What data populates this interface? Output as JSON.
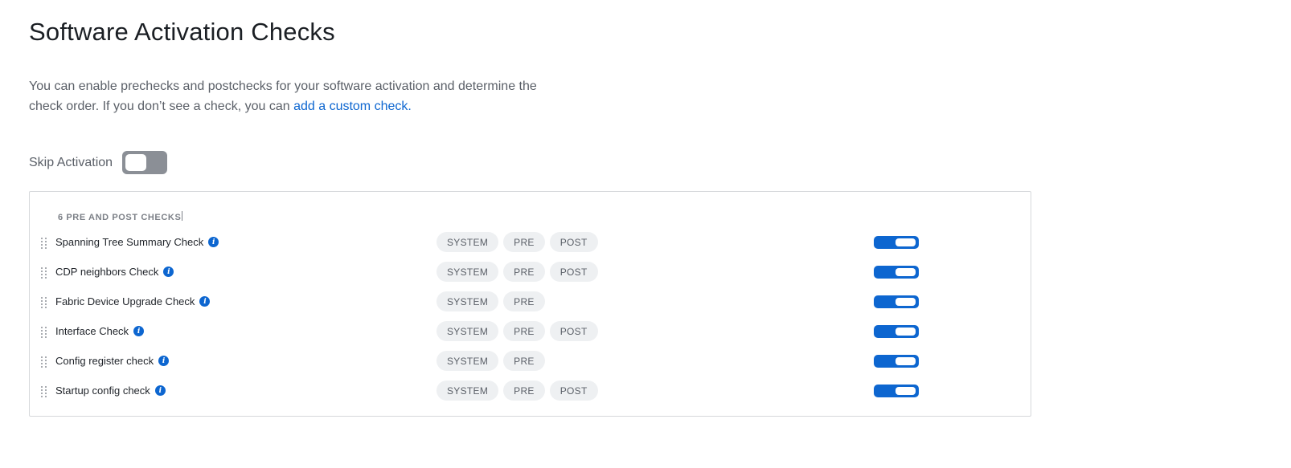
{
  "page": {
    "title": "Software Activation Checks",
    "description_text": "You can enable prechecks and postchecks for your software activation and determine the check order. If you don’t see a check, you can ",
    "description_link": "add a custom check."
  },
  "skip_activation": {
    "label": "Skip Activation",
    "enabled": false
  },
  "checks": {
    "header": "6 PRE AND POST CHECKS",
    "items": [
      {
        "name": "Spanning Tree Summary Check",
        "tags": [
          "SYSTEM",
          "PRE",
          "POST"
        ],
        "enabled": true
      },
      {
        "name": "CDP neighbors Check",
        "tags": [
          "SYSTEM",
          "PRE",
          "POST"
        ],
        "enabled": true
      },
      {
        "name": "Fabric Device Upgrade Check",
        "tags": [
          "SYSTEM",
          "PRE"
        ],
        "enabled": true
      },
      {
        "name": "Interface Check",
        "tags": [
          "SYSTEM",
          "PRE",
          "POST"
        ],
        "enabled": true
      },
      {
        "name": "Config register check",
        "tags": [
          "SYSTEM",
          "PRE"
        ],
        "enabled": true
      },
      {
        "name": "Startup config check",
        "tags": [
          "SYSTEM",
          "PRE",
          "POST"
        ],
        "enabled": true
      }
    ]
  },
  "icons": {
    "info": "info-icon",
    "drag": "drag-handle-icon"
  },
  "colors": {
    "accent": "#0d66d0",
    "toggle_off": "#8b8f96",
    "tag_bg": "#eef0f2"
  }
}
